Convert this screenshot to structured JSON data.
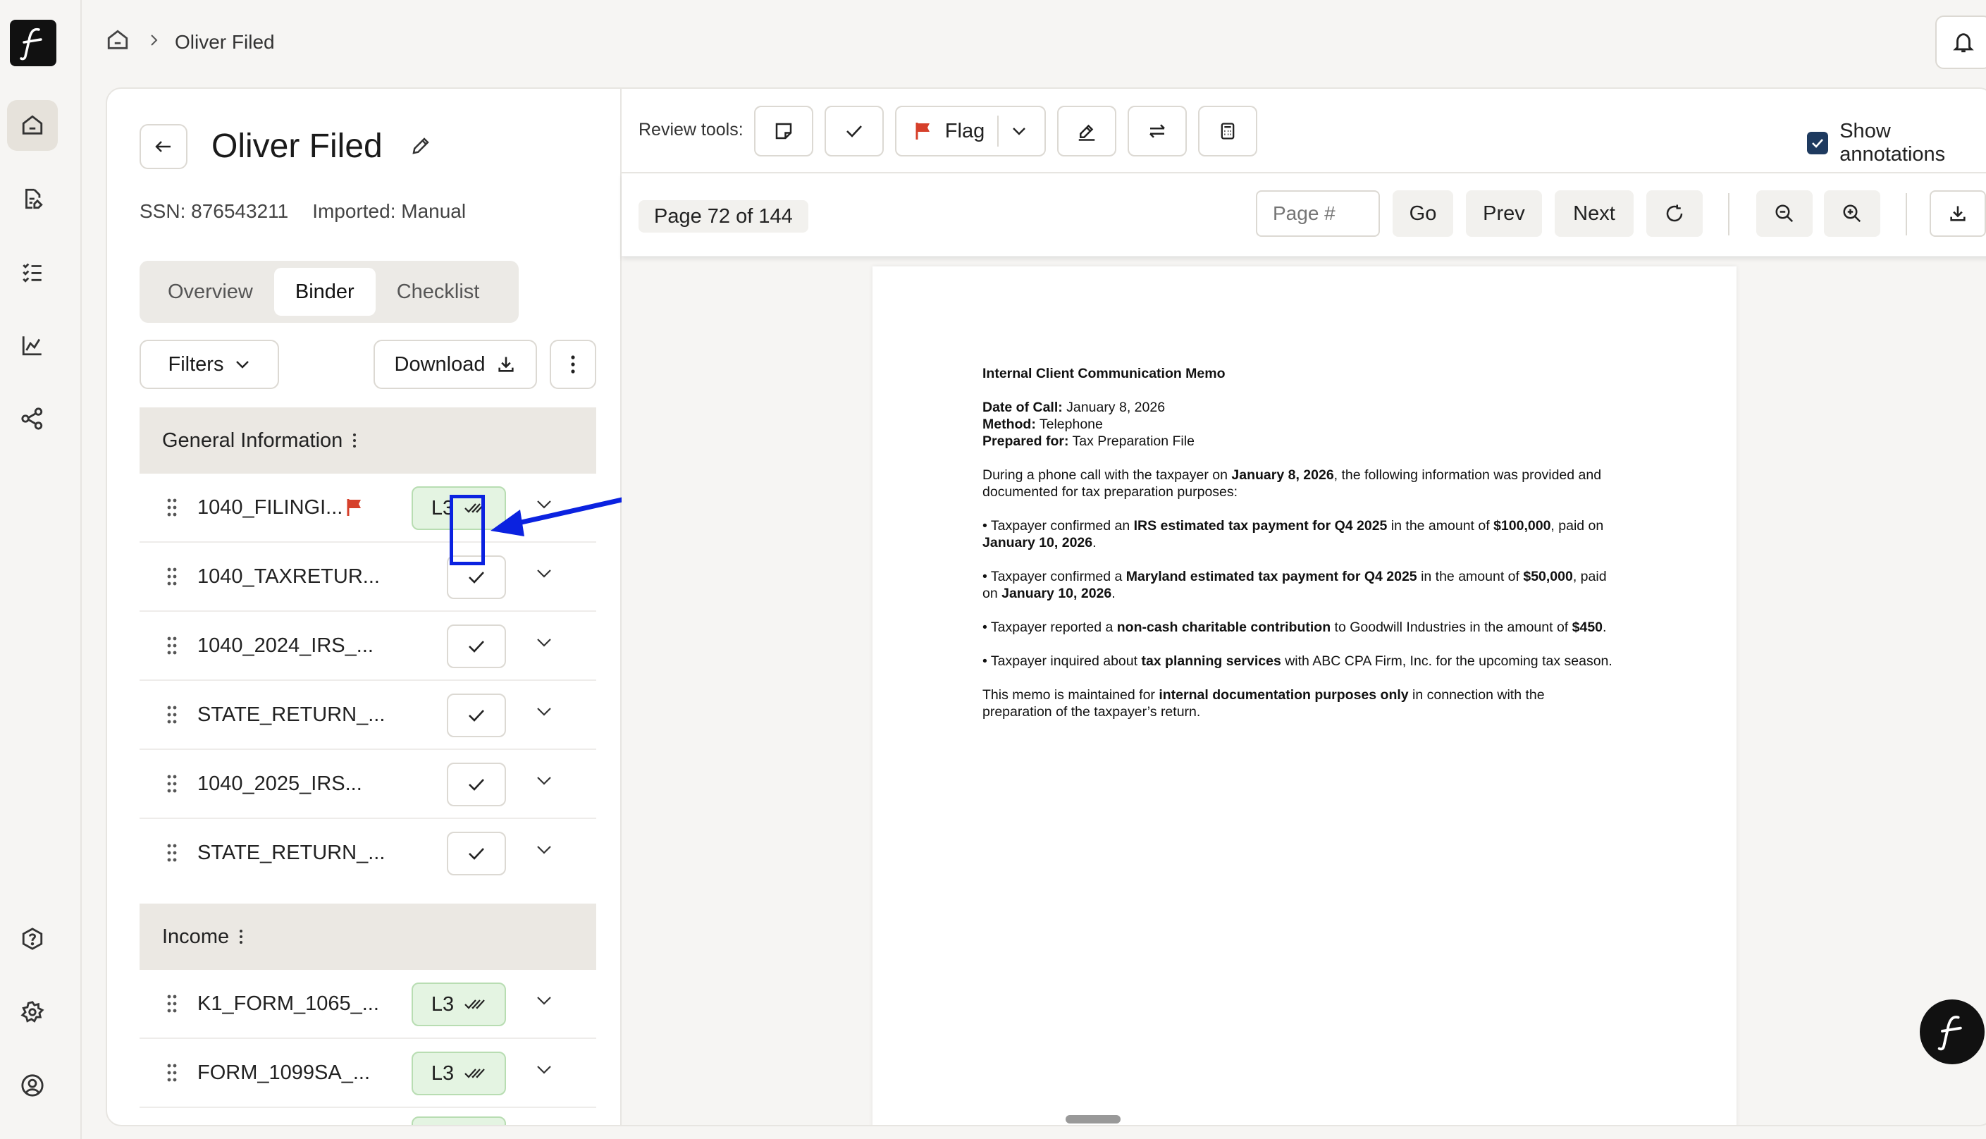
{
  "breadcrumb": {
    "current": "Oliver Filed"
  },
  "client": {
    "name": "Oliver Filed",
    "ssn": "SSN: 876543211",
    "imported": "Imported: Manual"
  },
  "tabs": [
    {
      "label": "Overview"
    },
    {
      "label": "Binder"
    },
    {
      "label": "Checklist"
    }
  ],
  "controls": {
    "filters": "Filters",
    "download": "Download"
  },
  "sections": [
    {
      "title": "General Information",
      "rows": [
        {
          "name": "1040_FILINGI...",
          "status": "L3",
          "flagged": true
        },
        {
          "name": "1040_TAXRETUR...",
          "status": "check"
        },
        {
          "name": "1040_2024_IRS_...",
          "status": "check"
        },
        {
          "name": "STATE_RETURN_...",
          "status": "check"
        },
        {
          "name": "1040_2025_IRS...",
          "status": "check"
        },
        {
          "name": "STATE_RETURN_...",
          "status": "check"
        }
      ]
    },
    {
      "title": "Income",
      "rows": [
        {
          "name": "K1_FORM_1065_...",
          "status": "L3"
        },
        {
          "name": "FORM_1099SA_...",
          "status": "L3"
        }
      ]
    }
  ],
  "review": {
    "label": "Review tools:",
    "flag_label": "Flag",
    "show_annotations": "Show annotations",
    "show_annotations_checked": true
  },
  "pager": {
    "indicator": "Page 72 of 144",
    "placeholder": "Page #",
    "go": "Go",
    "prev": "Prev",
    "next": "Next"
  },
  "document": {
    "title": "Internal Client Communication Memo",
    "date_label": "Date of Call:",
    "date_value": " January 8, 2026",
    "method_label": "Method:",
    "method_value": " Telephone",
    "prepared_label": "Prepared for:",
    "prepared_value": " Tax Preparation File",
    "intro_1": "During a phone call with the taxpayer on ",
    "intro_date": "January 8, 2026",
    "intro_2": ", the following information was provided and documented for tax preparation purposes:",
    "b1_1": "• Taxpayer confirmed an ",
    "b1_bold": "IRS estimated tax payment for Q4 2025",
    "b1_2": " in the amount of ",
    "b1_amount": "$100,000",
    "b1_3": ", paid on ",
    "b1_date": "January 10, 2026",
    "b1_4": ".",
    "b2_1": "• Taxpayer confirmed a ",
    "b2_bold": "Maryland estimated tax payment for Q4 2025",
    "b2_2": " in the amount of ",
    "b2_amount": "$50,000",
    "b2_3": ", paid on ",
    "b2_date": "January 10, 2026",
    "b2_4": ".",
    "b3_1": "• Taxpayer reported a ",
    "b3_bold": "non-cash charitable contribution",
    "b3_2": " to Goodwill Industries in the amount of ",
    "b3_amount": "$450",
    "b3_3": ".",
    "b4_1": "• Taxpayer inquired about ",
    "b4_bold": "tax planning services",
    "b4_2": " with ABC CPA Firm, Inc. for the upcoming tax season.",
    "close_1": "This memo is maintained for ",
    "close_bold": "internal documentation purposes only",
    "close_2": " in connection with the preparation of the taxpayer’s return."
  },
  "colors": {
    "accent_annotation": "#0b22e0",
    "flag_red": "#d6402b",
    "badge_green_bg": "#e4f4e2",
    "checkbox": "#1e3a5f"
  },
  "icons": {
    "rail": [
      "home-icon",
      "document-edit-icon",
      "checklist-icon",
      "chart-icon",
      "share-icon",
      "help-icon",
      "settings-icon",
      "account-icon"
    ]
  }
}
